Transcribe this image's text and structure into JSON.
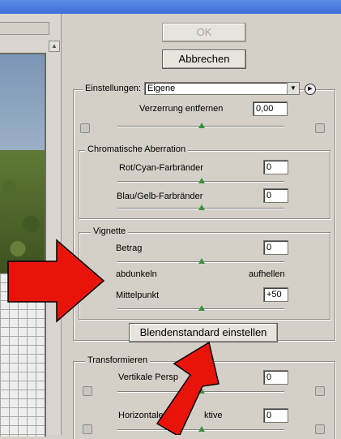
{
  "buttons": {
    "ok": "OK",
    "cancel": "Abbrechen",
    "vignette_default": "Blendenstandard einstellen"
  },
  "settings": {
    "label": "Einstellungen:",
    "selected": "Eigene"
  },
  "distortion": {
    "label": "Verzerrung entfernen",
    "value": "0,00",
    "slider_fraction": 0.5
  },
  "chromatic": {
    "title": "Chromatische Aberration",
    "red_cyan": {
      "label": "Rot/Cyan-Farbränder",
      "value": "0",
      "slider_fraction": 0.5
    },
    "blue_yellow": {
      "label": "Blau/Gelb-Farbränder",
      "value": "0",
      "slider_fraction": 0.5
    }
  },
  "vignette": {
    "title": "Vignette",
    "amount": {
      "label": "Betrag",
      "value": "0",
      "slider_fraction": 0.5
    },
    "darken_label": "abdunkeln",
    "lighten_label": "aufhellen",
    "midpoint": {
      "label": "Mittelpunkt",
      "value": "+50",
      "slider_fraction": 0.5
    }
  },
  "transform": {
    "title": "Transformieren",
    "vertical": {
      "label": "Vertikale Persp",
      "value": "0",
      "slider_fraction": 0.5
    },
    "horizontal": {
      "label": "Horizontale",
      "label_suffix": "ktive",
      "value": "0",
      "slider_fraction": 0.5
    }
  },
  "colors": {
    "arrow": "#e8140a",
    "thumb": "#3d8f3d",
    "panel": "#d4d0c8"
  },
  "icons": {
    "settings_menu": "circle-arrow-icon",
    "distortion_left": "barrel-distortion-icon",
    "distortion_right": "pincushion-distortion-icon",
    "vertical_left": "vertical-perspective-left-icon",
    "vertical_right": "vertical-perspective-right-icon",
    "horizontal_left": "horizontal-perspective-left-icon",
    "horizontal_right": "horizontal-perspective-right-icon"
  }
}
